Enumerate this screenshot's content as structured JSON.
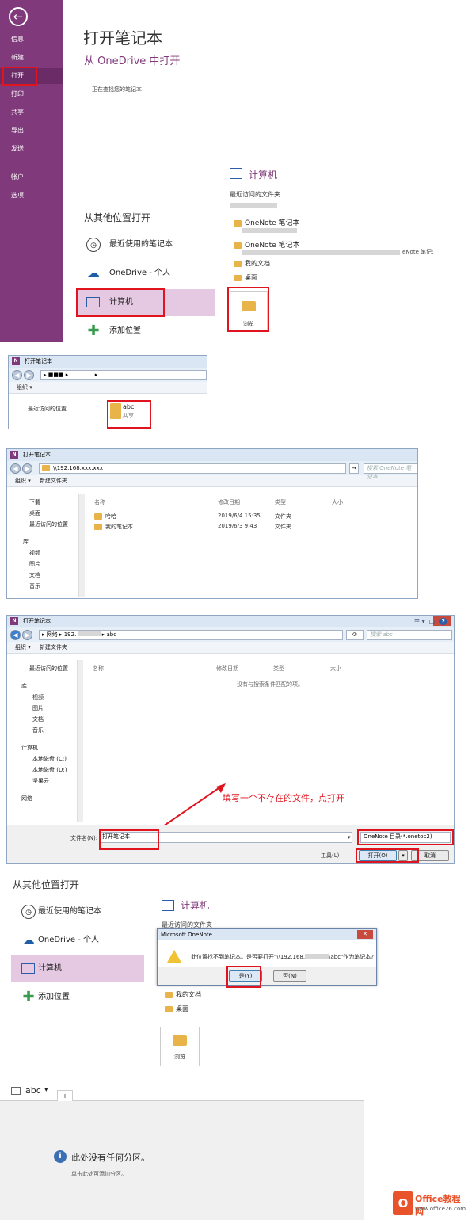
{
  "backstage": {
    "nav": [
      "信息",
      "新建",
      "打开",
      "打印",
      "共享",
      "导出",
      "发送",
      "帐户",
      "选项"
    ],
    "title": "打开笔记本",
    "subtitle": "从 OneDrive 中打开",
    "searching": "正在查找您的笔记本",
    "other_header": "从其他位置打开",
    "locations": [
      "最近使用的笔记本",
      "OneDrive - 个人",
      "计算机",
      "添加位置"
    ],
    "computer_header": "计算机",
    "recent_folders": "最近访问的文件夹",
    "folders": [
      "OneNote 笔记本",
      "OneNote 笔记本",
      "我的文档",
      "桌面"
    ],
    "note_suffix": "eNote 笔记:",
    "browse": "浏览"
  },
  "dialog1": {
    "title": "打开笔记本",
    "organize": "组织",
    "recent": "最近访问的位置",
    "folder_name": "abc",
    "folder_sub": "共享"
  },
  "dialog2": {
    "title": "打开笔记本",
    "address": "\\\\192.168.xxx.xxx",
    "search": "搜索 OneNote 笔记本",
    "organize": "组织",
    "new_folder": "新建文件夹",
    "tree": [
      "下载",
      "桌面",
      "最近访问的位置",
      "库",
      "视频",
      "图片",
      "文档",
      "音乐"
    ],
    "columns": [
      "名称",
      "修改日期",
      "类型",
      "大小"
    ],
    "rows": [
      {
        "name": "哈哈",
        "date": "2019/6/4 15:35",
        "type": "文件夹"
      },
      {
        "name": "我的笔记本",
        "date": "2019/6/3 9:43",
        "type": "文件夹"
      }
    ]
  },
  "dialog3": {
    "title": "打开笔记本",
    "breadcrumb": [
      "网络",
      "192.",
      "abc"
    ],
    "search": "搜索 abc",
    "organize": "组织",
    "new_folder": "新建文件夹",
    "tree": [
      "最近访问的位置",
      "库",
      "视频",
      "图片",
      "文档",
      "音乐",
      "计算机",
      "本地磁盘 (C:)",
      "本地磁盘 (D:)",
      "坚果云",
      "网络"
    ],
    "columns": [
      "名称",
      "修改日期",
      "类型",
      "大小"
    ],
    "empty": "没有与搜索条件匹配的项。",
    "annotation": "填写一个不存在的文件，点打开",
    "filename_label": "文件名(N):",
    "filename_value": "打开笔记本",
    "filetype": "OneNote 目录(*.onetoc2)",
    "tools": "工具(L)",
    "open": "打开(O)",
    "cancel": "取消"
  },
  "panel5": {
    "other_header": "从其他位置打开",
    "locations": [
      "最近使用的笔记本",
      "OneDrive - 个人",
      "计算机",
      "添加位置"
    ],
    "computer_header": "计算机",
    "recent_folders": "最近访问的文件夹",
    "folders": [
      "我的文档",
      "桌面"
    ],
    "browse": "浏览",
    "msg_title": "Microsoft OneNote",
    "msg_text_a": "此位置找不到笔记本。是否要打开\"\\\\192.168.",
    "msg_text_b": "\\abc\"作为笔记本?",
    "yes": "是(Y)",
    "no": "否(N)"
  },
  "panel6": {
    "notebook": "abc",
    "add_tab": "+",
    "no_section": "此处没有任何分区。",
    "add_hint": "单击此处可添加分区。"
  },
  "watermark": {
    "brand": "Office教程网",
    "url": "www.office26.com"
  }
}
